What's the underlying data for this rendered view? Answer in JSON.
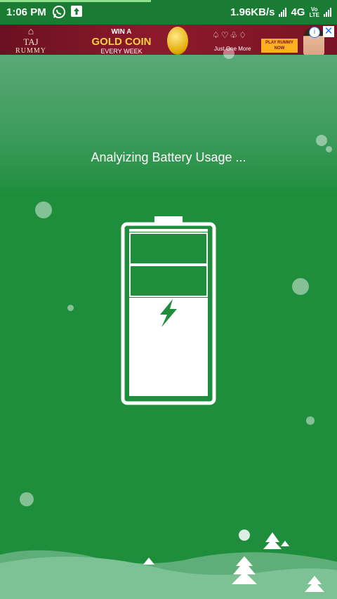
{
  "status_bar": {
    "time": "1:06 PM",
    "net_speed": "1.96KB/s",
    "network_type": "4G",
    "volte_top": "Vo",
    "volte_bottom": "LTE",
    "icons": [
      "whatsapp-icon",
      "upload-icon",
      "signal-icon",
      "signal-icon"
    ]
  },
  "ad": {
    "logo_line1": "TAJ",
    "logo_line2": "RUMMY",
    "win_text": "WIN A",
    "gold_text": "GOLD COIN",
    "every_text": "EVERY WEEK",
    "suits": "♤♡♧♢",
    "tagline": "Just One More",
    "cta_label": "PLAY RUMMY NOW",
    "info_icon": "info-icon",
    "close_icon": "close-icon"
  },
  "main": {
    "status_message": "Analyizing Battery Usage ..."
  },
  "colors": {
    "background": "#1f8e3c",
    "status_bar": "#1a7b33",
    "battery_stroke": "#ffffff"
  }
}
